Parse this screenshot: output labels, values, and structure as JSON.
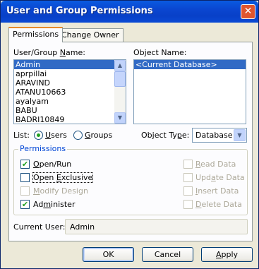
{
  "window": {
    "title": "User and Group Permissions",
    "close_glyph": "✕"
  },
  "tabs": [
    {
      "label": "Permissions",
      "active": true
    },
    {
      "label": "Change Owner",
      "active": false
    }
  ],
  "user_group": {
    "label_pre": "User/Group ",
    "label_key": "N",
    "label_post": "ame:",
    "items": [
      "Admin",
      "aprpillai",
      "ARAVIND",
      "ATANU10663",
      "ayalyam",
      "BABU",
      "BADRI10849"
    ],
    "selected_index": 0
  },
  "object_name": {
    "label": "Object Name:",
    "items": [
      "<Current Database>"
    ],
    "selected_index": 0
  },
  "list_type": {
    "label": "List:",
    "options": [
      {
        "label": "Users",
        "key": "U",
        "selected": true
      },
      {
        "label": "Groups",
        "key": "G",
        "selected": false
      }
    ]
  },
  "object_type": {
    "label_pre": "Object Ty",
    "label_key": "p",
    "label_post": "e:",
    "value": "Database"
  },
  "permissions": {
    "title": "Permissions",
    "left": [
      {
        "pre": "",
        "key": "O",
        "post": "pen/Run",
        "checked": true,
        "enabled": true
      },
      {
        "pre": "Open ",
        "key": "E",
        "post": "xclusive",
        "checked": false,
        "enabled": true,
        "focused": true
      },
      {
        "pre": "",
        "key": "M",
        "post": "odify Design",
        "checked": false,
        "enabled": false
      },
      {
        "pre": "Ad",
        "key": "m",
        "post": "inister",
        "checked": true,
        "enabled": true
      }
    ],
    "right": [
      {
        "pre": "",
        "key": "R",
        "post": "ead Data",
        "checked": false,
        "enabled": false
      },
      {
        "pre": "Upd",
        "key": "a",
        "post": "te Data",
        "checked": false,
        "enabled": false
      },
      {
        "pre": "",
        "key": "I",
        "post": "nsert Data",
        "checked": false,
        "enabled": false
      },
      {
        "pre": "",
        "key": "D",
        "post": "elete Data",
        "checked": false,
        "enabled": false
      }
    ]
  },
  "current_user": {
    "label": "Current User:",
    "value": "Admin"
  },
  "buttons": {
    "ok": "OK",
    "cancel": "Cancel",
    "apply_key": "A",
    "apply_post": "pply"
  },
  "colors": {
    "titlebar": "#0a46d0",
    "selection": "#316ac5",
    "tab_accent": "#e68b2c",
    "group_label": "#0046d5"
  }
}
